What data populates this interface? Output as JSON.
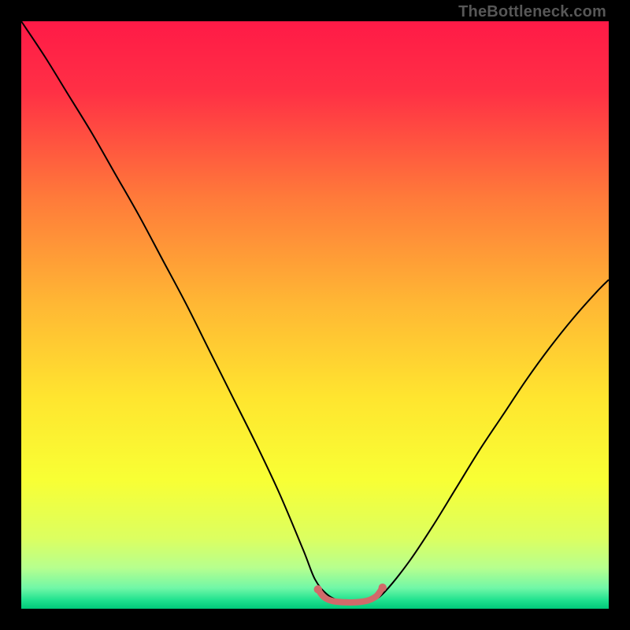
{
  "watermark": "TheBottleneck.com",
  "chart_data": {
    "type": "line",
    "title": "",
    "xlabel": "",
    "ylabel": "",
    "xlim": [
      0,
      100
    ],
    "ylim": [
      0,
      100
    ],
    "grid": false,
    "legend": false,
    "background_gradient": [
      {
        "offset": 0.0,
        "color": "#ff1a47"
      },
      {
        "offset": 0.12,
        "color": "#ff3045"
      },
      {
        "offset": 0.3,
        "color": "#ff7a3a"
      },
      {
        "offset": 0.48,
        "color": "#ffb734"
      },
      {
        "offset": 0.64,
        "color": "#ffe52f"
      },
      {
        "offset": 0.78,
        "color": "#f8ff34"
      },
      {
        "offset": 0.88,
        "color": "#dcff60"
      },
      {
        "offset": 0.93,
        "color": "#b7ff8e"
      },
      {
        "offset": 0.965,
        "color": "#70f7a7"
      },
      {
        "offset": 0.985,
        "color": "#21e28f"
      },
      {
        "offset": 1.0,
        "color": "#00c97a"
      }
    ],
    "series": [
      {
        "name": "bottleneck-curve",
        "color": "#000000",
        "width": 2,
        "x": [
          0,
          4,
          8,
          12,
          16,
          20,
          24,
          28,
          32,
          36,
          40,
          44,
          48,
          50,
          52,
          54,
          56,
          58,
          60,
          62,
          66,
          70,
          74,
          78,
          82,
          86,
          90,
          94,
          98,
          100
        ],
        "y": [
          100,
          94,
          87.5,
          81,
          74,
          67,
          59.5,
          52,
          44,
          36,
          28,
          19.5,
          10,
          5,
          2.5,
          1.4,
          1.2,
          1.2,
          1.5,
          3,
          8,
          14,
          20.5,
          27,
          33,
          39,
          44.5,
          49.5,
          54,
          56
        ]
      },
      {
        "name": "optimal-zone-marker",
        "color": "#d16a6a",
        "width": 8,
        "linecap": "round",
        "x": [
          50.5,
          51.5,
          53,
          55,
          57,
          59,
          60.5,
          61.5
        ],
        "y": [
          3.3,
          2.0,
          1.3,
          1.1,
          1.1,
          1.4,
          2.2,
          3.6
        ]
      }
    ],
    "markers": [
      {
        "series": "optimal-zone-marker",
        "x": 50.5,
        "y": 3.3,
        "r": 5.2,
        "color": "#d16a6a"
      },
      {
        "series": "optimal-zone-marker",
        "x": 61.5,
        "y": 3.6,
        "r": 5.2,
        "color": "#d16a6a"
      }
    ]
  }
}
